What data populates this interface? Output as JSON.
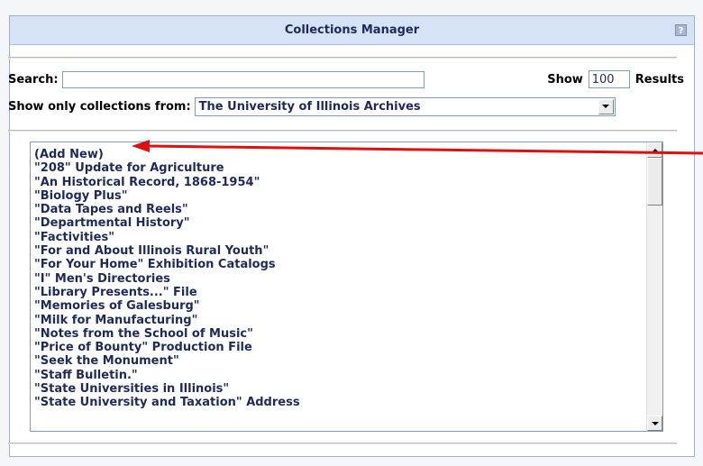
{
  "window": {
    "title": "Collections Manager",
    "help_icon": "help-icon"
  },
  "search": {
    "label": "Search:",
    "value": ""
  },
  "results": {
    "show_label": "Show",
    "count": "100",
    "results_label": "Results"
  },
  "filter": {
    "label": "Show only collections from:",
    "selected": "The University of Illinois Archives"
  },
  "list": {
    "items": [
      "(Add New)",
      "\"208\" Update for Agriculture",
      "\"An Historical Record, 1868-1954\"",
      "\"Biology Plus\"",
      "\"Data Tapes and Reels\"",
      "\"Departmental History\"",
      "\"Factivities\"",
      "\"For and About Illinois Rural Youth\"",
      "\"For Your Home\" Exhibition Catalogs",
      "\"I\" Men's Directories",
      "\"Library Presents...\" File",
      "\"Memories of Galesburg\"",
      "\"Milk for Manufacturing\"",
      "\"Notes from the School of Music\"",
      "\"Price of Bounty\" Production File",
      "\"Seek the Monument\"",
      "\"Staff Bulletin.\"",
      "\"State Universities in Illinois\"",
      "\"State University and Taxation\" Address"
    ]
  },
  "annotation": {
    "color": "#e01010"
  }
}
